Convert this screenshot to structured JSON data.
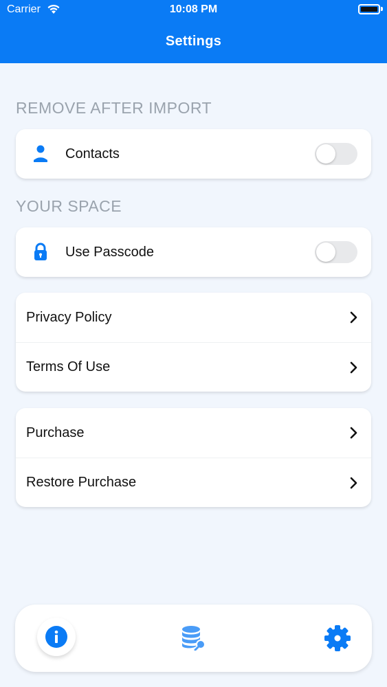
{
  "status_bar": {
    "carrier": "Carrier",
    "time": "10:08 PM"
  },
  "header": {
    "title": "Settings"
  },
  "sections": {
    "remove_after_import": {
      "title": "REMOVE AFTER IMPORT",
      "contacts": {
        "label": "Contacts",
        "icon": "person-icon",
        "toggle_on": false
      }
    },
    "your_space": {
      "title": "YOUR SPACE",
      "passcode": {
        "label": "Use Passcode",
        "icon": "lock-icon",
        "toggle_on": false
      }
    }
  },
  "links": [
    {
      "label": "Privacy Policy"
    },
    {
      "label": "Terms Of Use"
    }
  ],
  "purchases": [
    {
      "label": "Purchase"
    },
    {
      "label": "Restore Purchase"
    }
  ],
  "tabbar": {
    "items": [
      {
        "icon": "info-icon",
        "active": true
      },
      {
        "icon": "database-icon",
        "active": false
      },
      {
        "icon": "gear-icon",
        "active": false
      }
    ]
  },
  "colors": {
    "accent": "#0a7bf5",
    "background": "#f1f6fd",
    "section_title": "#9aa3ad",
    "toggle_off": "#e8e9eb"
  }
}
